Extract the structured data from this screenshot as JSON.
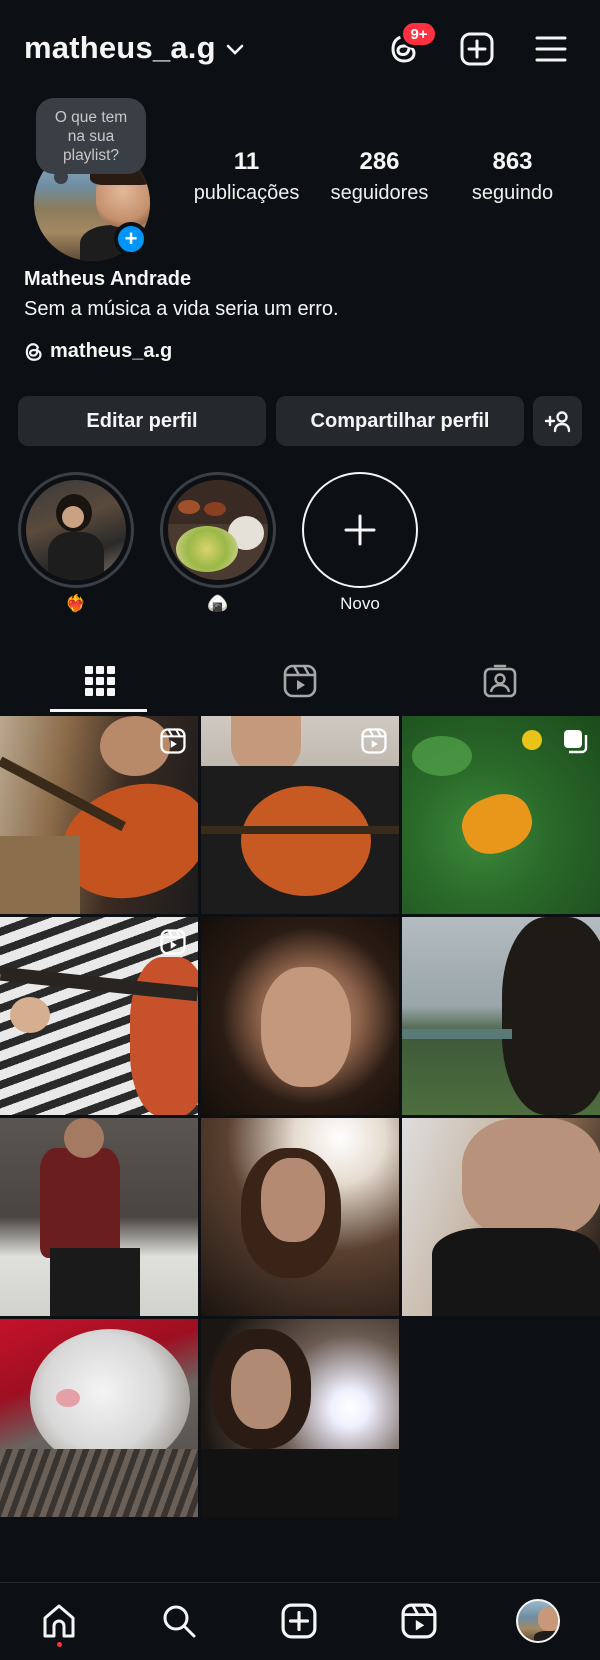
{
  "header": {
    "username": "matheus_a.g",
    "notifications_badge": "9+"
  },
  "profile": {
    "note_lines": [
      "O que tem",
      "na sua",
      "playlist?"
    ],
    "stats": [
      {
        "value": "11",
        "label": "publicações"
      },
      {
        "value": "286",
        "label": "seguidores"
      },
      {
        "value": "863",
        "label": "seguindo"
      }
    ],
    "name": "Matheus Andrade",
    "bio": "Sem a música a vida seria um erro.",
    "threads_handle": "matheus_a.g"
  },
  "buttons": {
    "edit_profile": "Editar perfil",
    "share_profile": "Compartilhar perfil"
  },
  "highlights": [
    {
      "label": "❤️‍🔥"
    },
    {
      "label": "🍙"
    },
    {
      "label": "Novo"
    }
  ],
  "tabs": [
    "grid-icon",
    "reels-icon",
    "tagged-icon"
  ],
  "posts": [
    {
      "type": "reel",
      "subject": "guitar"
    },
    {
      "type": "reel",
      "subject": "guitar"
    },
    {
      "type": "carousel",
      "subject": "butterfly"
    },
    {
      "type": "reel",
      "subject": "guitar-striped"
    },
    {
      "type": "photo",
      "subject": "portrait"
    },
    {
      "type": "photo",
      "subject": "lake-portrait"
    },
    {
      "type": "photo",
      "subject": "room"
    },
    {
      "type": "photo",
      "subject": "portrait-sun"
    },
    {
      "type": "photo",
      "subject": "portrait-smile"
    },
    {
      "type": "photo",
      "subject": "cat"
    },
    {
      "type": "photo",
      "subject": "portrait-flash"
    }
  ],
  "bottom_nav": [
    "home-icon",
    "search-icon",
    "create-icon",
    "reels-icon",
    "profile-avatar"
  ],
  "colors": {
    "background": "#0c1014",
    "button": "#25292e",
    "badge": "#ff3040",
    "accent": "#0095f6"
  }
}
